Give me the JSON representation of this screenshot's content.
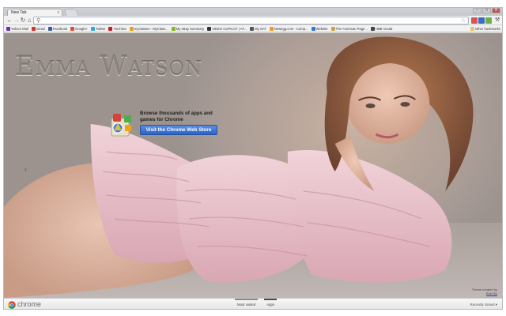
{
  "browser": {
    "tab_title": "New Tab",
    "tab_close_glyph": "x",
    "window_controls": [
      "–",
      "□",
      "✕"
    ]
  },
  "toolbar": {
    "back_glyph": "←",
    "forward_glyph": "→",
    "reload_glyph": "↻",
    "home_glyph": "⌂",
    "search_glyph": "⚲",
    "star_glyph": "☆",
    "wrench_glyph": "⚒"
  },
  "bookmarks": {
    "items": [
      {
        "label": "Yahoo! Mail",
        "color": "#6a2fa8"
      },
      {
        "label": "Gmail",
        "color": "#d93025"
      },
      {
        "label": "Facebook",
        "color": "#3b5998"
      },
      {
        "label": "Google+",
        "color": "#dd4b39"
      },
      {
        "label": "Twitter",
        "color": "#2aa9e0"
      },
      {
        "label": "YouTube",
        "color": "#cc181e"
      },
      {
        "label": "myclasses - MyClass...",
        "color": "#e6a117"
      },
      {
        "label": "My eBay Summary",
        "color": "#86b817"
      },
      {
        "label": "VIDEO COPILOT | AF...",
        "color": "#333333"
      },
      {
        "label": "My SAT",
        "color": "#555555"
      },
      {
        "label": "Newegg.com - Comp...",
        "color": "#f49b1b"
      },
      {
        "label": "Website",
        "color": "#2f7ad6"
      },
      {
        "label": "The American Page...",
        "color": "#c7a248"
      },
      {
        "label": "HBB Vocab",
        "color": "#444444"
      }
    ],
    "other_label": "Other bookmarks"
  },
  "theme": {
    "title": "Emma Watson",
    "credit_line1": "Theme created by",
    "credit_line2": "Bob Riz",
    "left_arrow_glyph": "‹"
  },
  "promo": {
    "text": "Browse thousands of apps and games for Chrome",
    "button_label": "Visit the Chrome Web Store"
  },
  "bottom_bar": {
    "brand": "chrome",
    "tabs": [
      {
        "label": "Most visited",
        "active": false
      },
      {
        "label": "Apps",
        "active": true
      }
    ],
    "recently_closed_label": "Recently closed",
    "recently_closed_glyph": "▾"
  }
}
